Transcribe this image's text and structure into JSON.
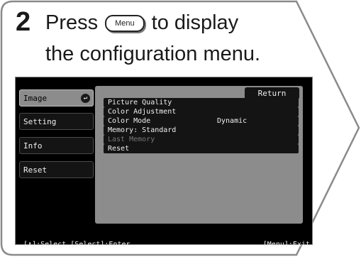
{
  "step": {
    "number": "2",
    "press_text": "Press",
    "key_label": "Menu",
    "after_key_text": "to display",
    "line2": "the configuration menu."
  },
  "menu": {
    "tabs": [
      {
        "label": "Image",
        "active": true
      },
      {
        "label": "Setting",
        "active": false
      },
      {
        "label": "Info",
        "active": false
      },
      {
        "label": "Reset",
        "active": false
      }
    ],
    "return_label": "Return",
    "items": [
      {
        "label": "Picture Quality",
        "value": "",
        "enabled": true
      },
      {
        "label": "Color Adjustment",
        "value": "",
        "enabled": true
      },
      {
        "label": "Color Mode",
        "value": "Dynamic",
        "enabled": true
      },
      {
        "label": "Memory: Standard",
        "value": "",
        "enabled": true
      },
      {
        "label": "Last Memory",
        "value": "",
        "enabled": false
      },
      {
        "label": "Reset",
        "value": "",
        "enabled": true
      }
    ],
    "footer_left_bracket_open": "[",
    "footer_left_rest": "]:Select [Select]:Enter",
    "footer_right": "[Menu]:Exit"
  },
  "icons": {
    "enter_icon": "enter-arrow-icon",
    "updown_icon": "up-down-arrow-icon"
  },
  "colors": {
    "screen_bg": "#000000",
    "panel_bg": "#8c8c8c",
    "item_bg": "#141414",
    "card_border": "#888888"
  }
}
